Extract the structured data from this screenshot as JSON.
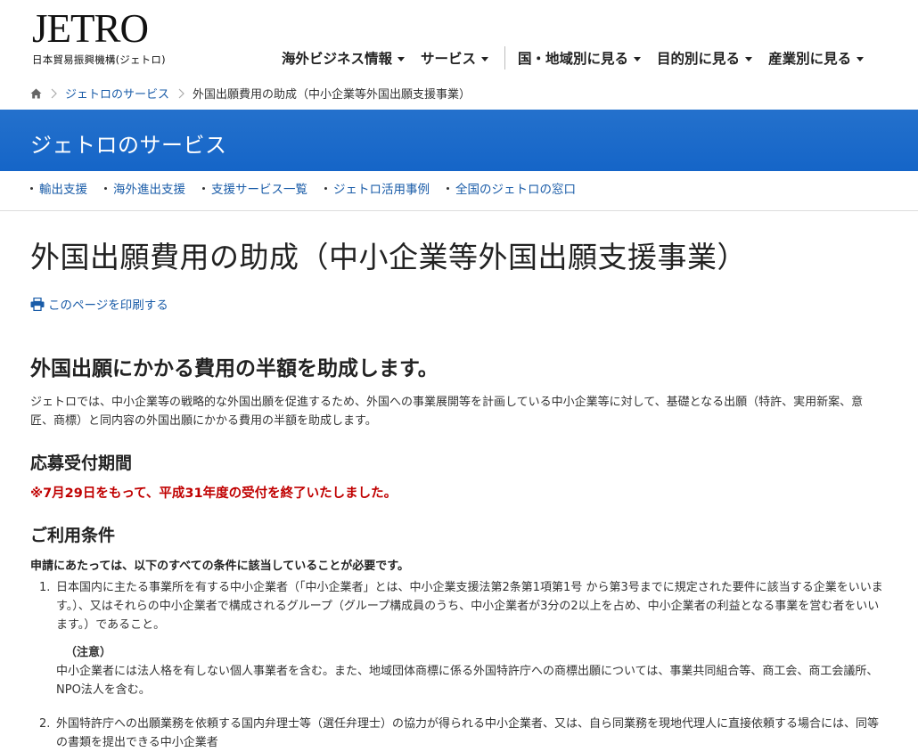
{
  "header": {
    "logo": "JETRO",
    "logo_sub": "日本貿易振興機構(ジェトロ)",
    "nav": [
      {
        "label": "海外ビジネス情報"
      },
      {
        "label": "サービス"
      },
      {
        "label": "国・地域別に見る"
      },
      {
        "label": "目的別に見る"
      },
      {
        "label": "産業別に見る"
      }
    ]
  },
  "breadcrumb": {
    "items": [
      "ジェトロのサービス",
      "外国出願費用の助成（中小企業等外国出願支援事業）"
    ]
  },
  "banner": {
    "title": "ジェトロのサービス"
  },
  "subnav": {
    "items": [
      "輸出支援",
      "海外進出支援",
      "支援サービス一覧",
      "ジェトロ活用事例",
      "全国のジェトロの窓口"
    ]
  },
  "main": {
    "title": "外国出願費用の助成（中小企業等外国出願支援事業）",
    "print_label": "このページを印刷する",
    "lead_heading": "外国出願にかかる費用の半額を助成します。",
    "intro": "ジェトロでは、中小企業等の戦略的な外国出願を促進するため、外国への事業展開等を計画している中小企業等に対して、基礎となる出願（特許、実用新案、意匠、商標）と同内容の外国出願にかかる費用の半額を助成します。",
    "period_heading": "応募受付期間",
    "period_notice": "※7月29日をもって、平成31年度の受付を終了いたしました。",
    "conditions_heading": "ご利用条件",
    "conditions_lead": "申請にあたっては、以下のすべての条件に該当していることが必要です。",
    "conditions": [
      {
        "num": "1.",
        "text": "日本国内に主たる事業所を有する中小企業者（「中小企業者」とは、中小企業支援法第2条第1項第1号 から第3号までに規定された要件に該当する企業をいいます。）、又はそれらの中小企業者で構成されるグループ（グループ構成員のうち、中小企業者が3分の2以上を占め、中小企業者の利益となる事業を営む者をいいます。）であること。",
        "note_title": "（注意）",
        "note_text": "中小企業者には法人格を有しない個人事業者を含む。また、地域団体商標に係る外国特許庁への商標出願については、事業共同組合等、商工会、商工会議所、NPO法人を含む。"
      },
      {
        "num": "2.",
        "text": "外国特許庁への出願業務を依頼する国内弁理士等（選任弁理士）の協力が得られる中小企業者、又は、自ら同業務を現地代理人に直接依頼する場合には、同等の書類を提出できる中小企業者"
      }
    ]
  },
  "colors": {
    "brand_blue": "#1565c8",
    "link_blue": "#1a5ca8",
    "notice_red": "#c00000"
  }
}
